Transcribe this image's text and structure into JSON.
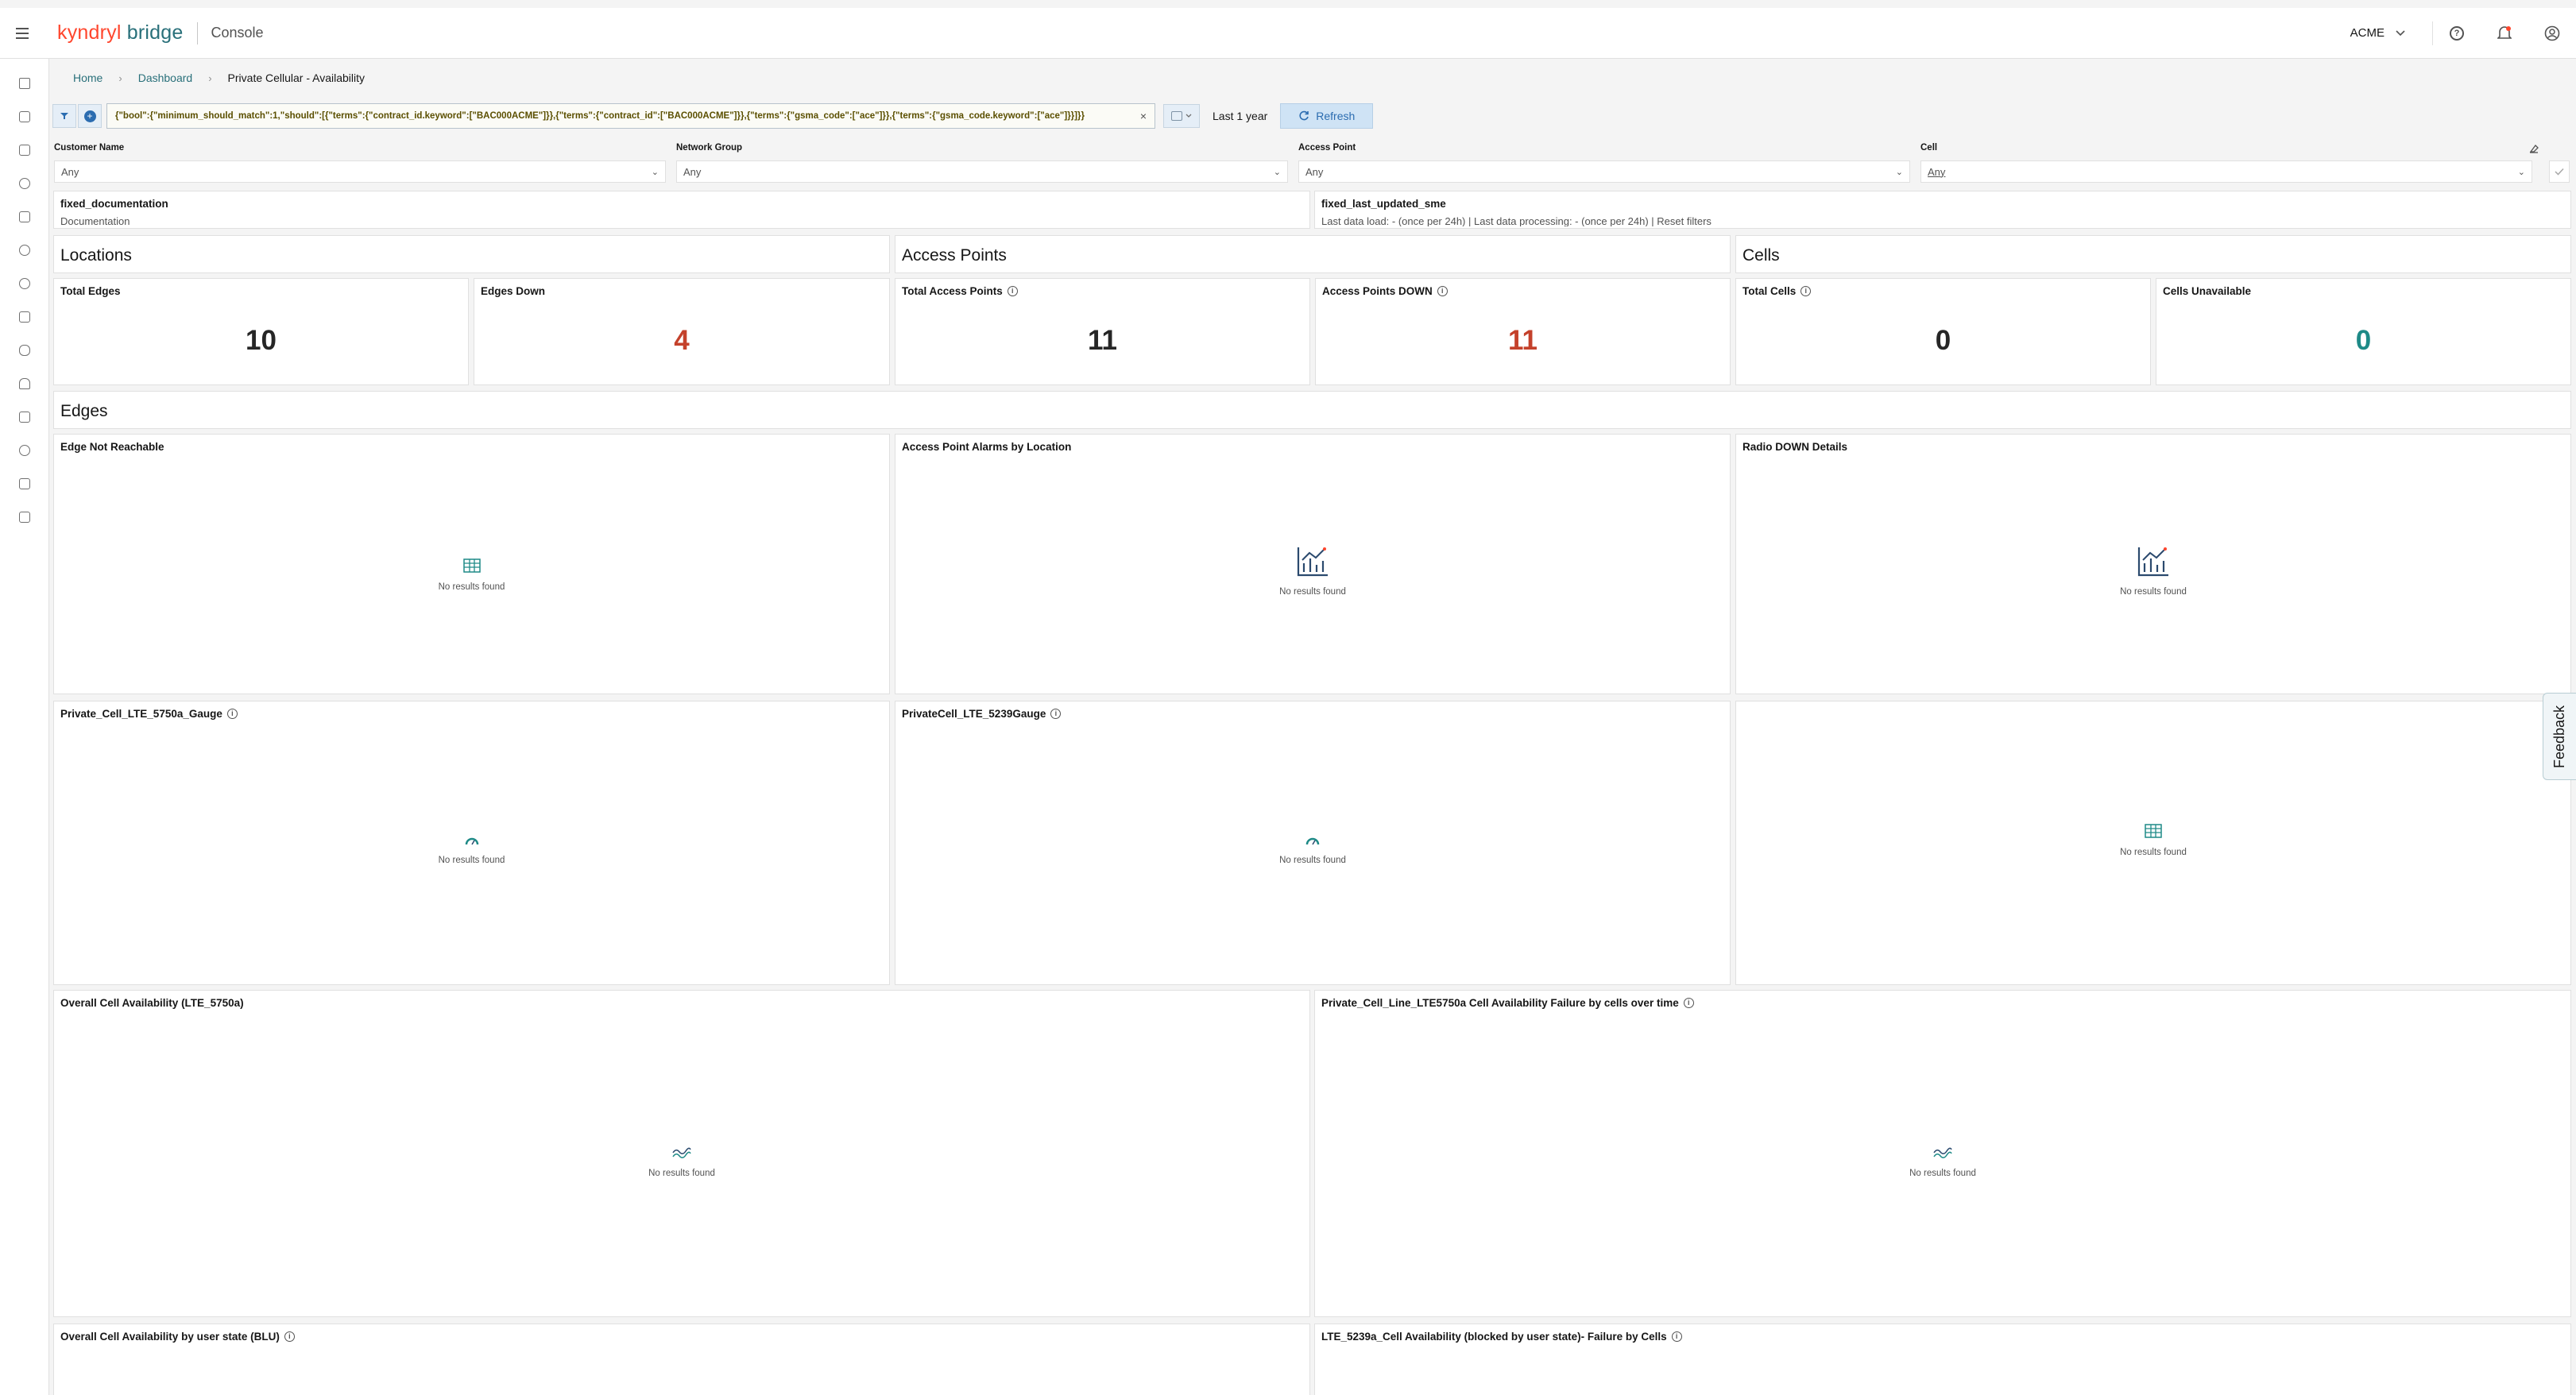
{
  "header": {
    "brand_primary": "kyndryl",
    "brand_secondary": "bridge",
    "console_label": "Console",
    "account": "ACME"
  },
  "breadcrumb": {
    "home": "Home",
    "dashboard": "Dashboard",
    "current": "Private Cellular - Availability"
  },
  "query": {
    "text": "{\"bool\":{\"minimum_should_match\":1,\"should\":[{\"terms\":{\"contract_id.keyword\":[\"BAC000ACME\"]}},{\"terms\":{\"contract_id\":[\"BAC000ACME\"]}},{\"terms\":{\"gsma_code\":[\"ace\"]}},{\"terms\":{\"gsma_code.keyword\":[\"ace\"]}}]}}",
    "time_range": "Last 1 year",
    "refresh_label": "Refresh"
  },
  "controls": [
    {
      "label": "Customer Name",
      "value": "Any"
    },
    {
      "label": "Network Group",
      "value": "Any"
    },
    {
      "label": "Access Point",
      "value": "Any"
    },
    {
      "label": "Cell",
      "value": "Any"
    }
  ],
  "info_panels": {
    "documentation": {
      "title": "fixed_documentation",
      "body": "Documentation"
    },
    "last_updated": {
      "title": "fixed_last_updated_sme",
      "body": "Last data load: - (once per 24h) | Last data processing: - (once per 24h) | Reset filters"
    }
  },
  "sections": {
    "locations": "Locations",
    "access_points": "Access Points",
    "cells": "Cells",
    "edges": "Edges"
  },
  "metrics": [
    {
      "title": "Total Edges",
      "value": "10",
      "color": "#262626",
      "info": false
    },
    {
      "title": "Edges Down",
      "value": "4",
      "color": "#c4412b",
      "info": false
    },
    {
      "title": "Total Access Points",
      "value": "11",
      "color": "#262626",
      "info": true
    },
    {
      "title": "Access Points DOWN",
      "value": "11",
      "color": "#c4412b",
      "info": true
    },
    {
      "title": "Total Cells",
      "value": "0",
      "color": "#262626",
      "info": true
    },
    {
      "title": "Cells Unavailable",
      "value": "0",
      "color": "#1e8a87",
      "info": false
    }
  ],
  "charts": {
    "edge_not_reachable": {
      "title": "Edge Not Reachable",
      "empty": "No results found",
      "icon": "table-icon"
    },
    "ap_alarms_by_location": {
      "title": "Access Point Alarms by Location",
      "empty": "No results found",
      "icon": "bar-chart-icon"
    },
    "radio_down_details": {
      "title": "Radio DOWN Details",
      "empty": "No results found",
      "icon": "bar-chart-icon"
    },
    "gauge_5750a": {
      "title": "Private_Cell_LTE_5750a_Gauge",
      "empty": "No results found",
      "icon": "gauge-icon"
    },
    "gauge_5239": {
      "title": "PrivateCell_LTE_5239Gauge",
      "empty": "No results found",
      "icon": "gauge-icon"
    },
    "untitled_table": {
      "title": "",
      "empty": "No results found",
      "icon": "table-icon"
    },
    "overall_cell_availability": {
      "title": "Overall Cell Availability (LTE_5750a)",
      "empty": "No results found",
      "icon": "line-chart-icon"
    },
    "cell_availability_failure": {
      "title": "Private_Cell_Line_LTE5750a Cell Availability Failure by cells over time",
      "empty": "No results found",
      "icon": "line-chart-icon"
    },
    "availability_by_user_state": {
      "title": "Overall Cell Availability by user state (BLU)"
    },
    "lte_5239a_failure": {
      "title": "LTE_5239a_Cell Availability (blocked by user state)- Failure by Cells"
    }
  },
  "feedback_label": "Feedback",
  "colors": {
    "accent": "#29707a",
    "brand_red": "#ff462d",
    "danger": "#c4412b",
    "success": "#1e8a87"
  }
}
